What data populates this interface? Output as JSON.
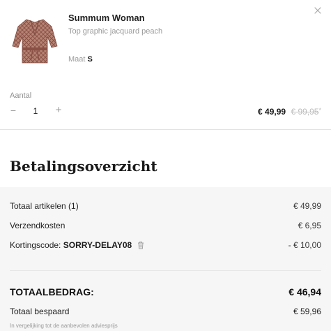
{
  "cart_item": {
    "brand": "Summum Woman",
    "name": "Top graphic jacquard peach",
    "size_label": "Maat",
    "size_value": "S",
    "quantity_label": "Aantal",
    "quantity_minus": "−",
    "quantity_value": "1",
    "quantity_plus": "+",
    "price_now": "€ 49,99",
    "price_old": "€ 99,95",
    "price_footnote_mark": "*",
    "remove_icon": "close-icon",
    "image_colors": {
      "garment": "#b07d6b",
      "pattern": "#8a4f45"
    }
  },
  "summary": {
    "title": "Betalingsoverzicht",
    "rows": [
      {
        "label": "Totaal artikelen (1)",
        "value": "€ 49,99"
      },
      {
        "label": "Verzendkosten",
        "value": "€ 6,95"
      }
    ],
    "coupon": {
      "label": "Kortingscode:",
      "code": "SORRY-DELAY08",
      "value": "- € 10,00",
      "icon": "trash-icon"
    },
    "total_label": "TOTAALBEDRAG:",
    "total_value": "€ 46,94",
    "saved_label": "Totaal bespaard",
    "saved_value": "€ 59,96",
    "footnote": "In vergelijking tot de aanbevolen adviesprijs"
  }
}
